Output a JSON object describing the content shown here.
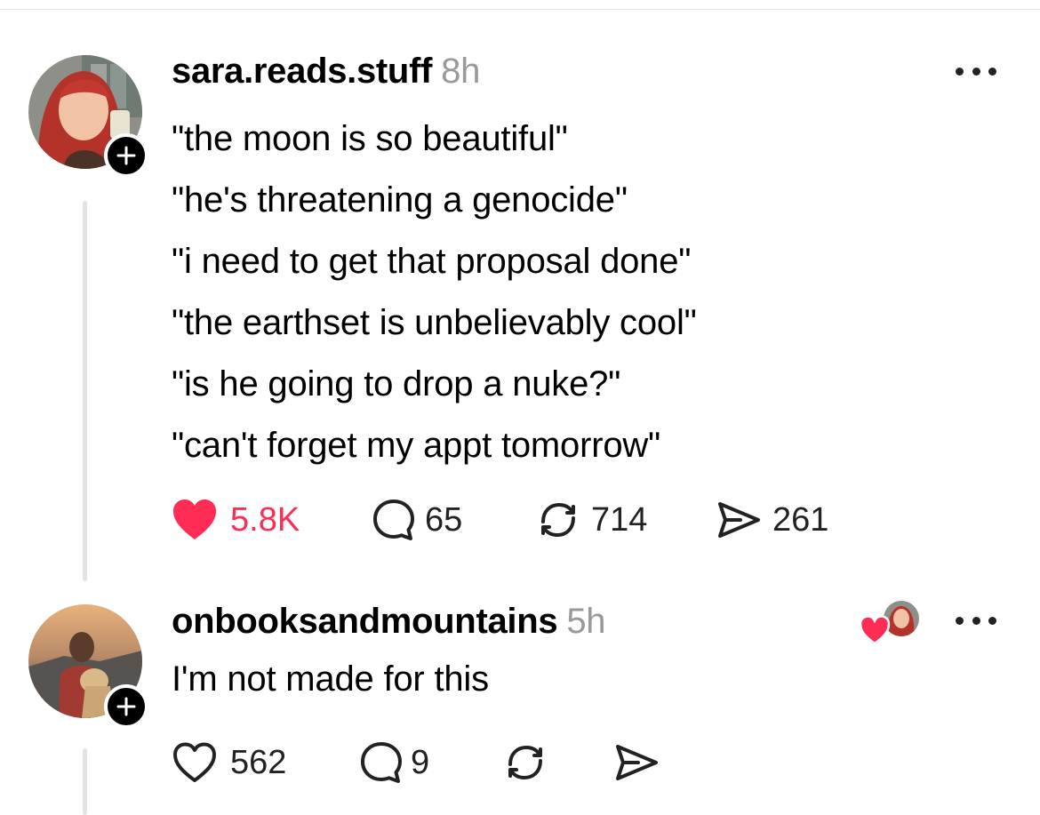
{
  "post": {
    "username": "sara.reads.stuff",
    "time": "8h",
    "lines": [
      "\"the moon is so beautiful\"",
      "\"he's threatening a genocide\"",
      "\"i need to get that proposal done\"",
      "\"the earthset is unbelievably cool\"",
      "\"is he going to drop a nuke?\"",
      "\"can't forget my appt tomorrow\""
    ],
    "likes": "5.8K",
    "comments": "65",
    "reposts": "714",
    "shares": "261",
    "liked": true
  },
  "reply": {
    "username": "onbooksandmountains",
    "time": "5h",
    "text": "I'm not made for this",
    "likes": "562",
    "comments": "9",
    "liked_by_author": true
  },
  "colors": {
    "like_red": "#ff2d55",
    "muted_gray": "#999999",
    "thread_line": "#e3e3e3"
  },
  "icons": [
    "heart-icon",
    "comment-icon",
    "repost-icon",
    "share-icon",
    "more-icon",
    "plus-icon"
  ]
}
